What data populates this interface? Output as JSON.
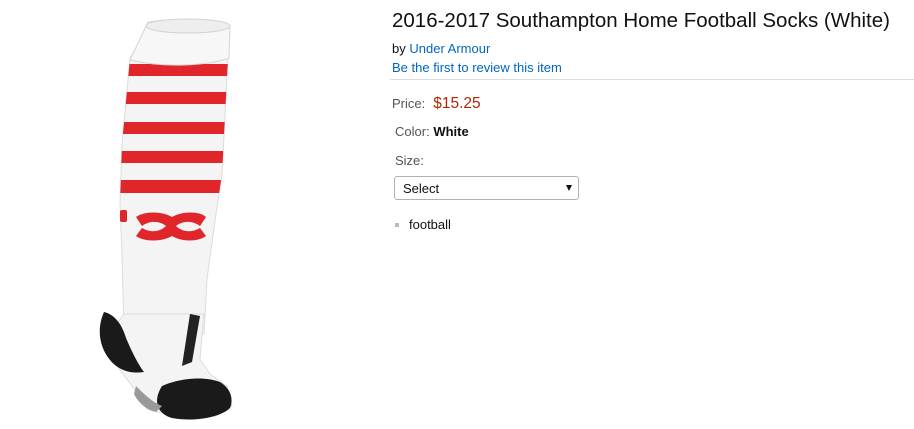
{
  "product": {
    "title": "2016-2017 Southampton Home Football Socks (White)",
    "by_prefix": "by",
    "brand": "Under Armour",
    "review_link": "Be the first to review this item",
    "image_icon": "sock-product-image",
    "price": {
      "label": "Price:",
      "value": "$15.25",
      "color": "#b12704"
    },
    "color": {
      "label": "Color:",
      "value": "White"
    },
    "size": {
      "label": "Size:",
      "selected": "Select"
    },
    "features": [
      "football"
    ]
  },
  "colors": {
    "link": "#0066c0",
    "price": "#b12704",
    "stripe": "#e0262b"
  }
}
